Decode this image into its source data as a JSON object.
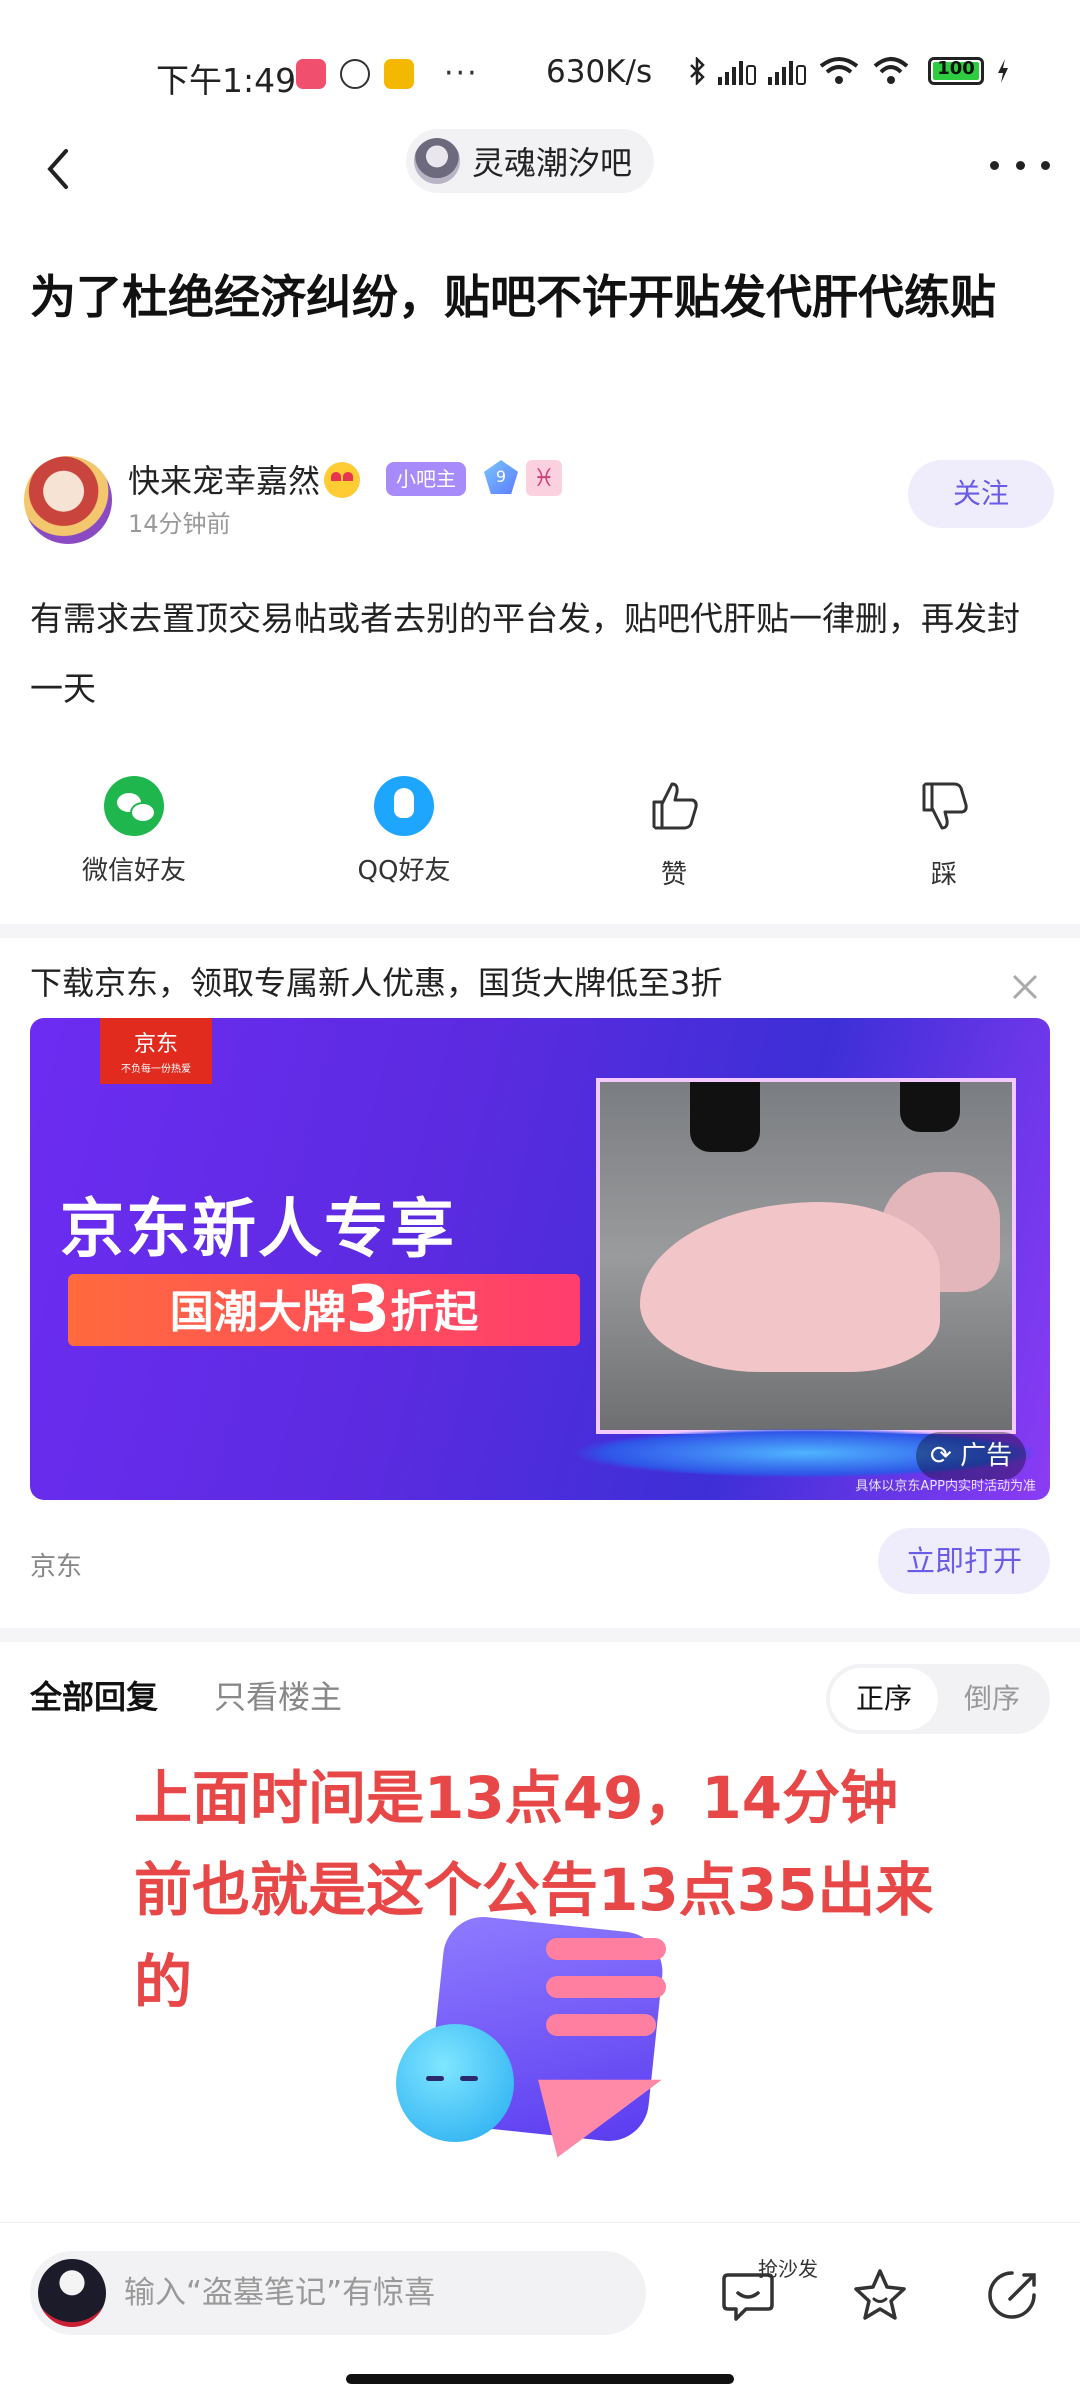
{
  "status_bar": {
    "time": "下午1:49",
    "net_speed": "630K/s",
    "battery": "100"
  },
  "nav": {
    "forum_name": "灵魂潮汐吧"
  },
  "post": {
    "title": "为了杜绝经济纠纷，贴吧不许开贴发代肝代练贴",
    "author": {
      "name": "快来宠幸嘉然",
      "role_badge": "小吧主",
      "level": "9",
      "zodiac": "♓",
      "time_ago": "14分钟前"
    },
    "follow_label": "关注",
    "body": "有需求去置顶交易帖或者去别的平台发，贴吧代肝贴一律删，再发封一天"
  },
  "share": {
    "wechat": "微信好友",
    "qq": "QQ好友",
    "like": "赞",
    "dislike": "踩"
  },
  "ad": {
    "caption": "下载京东，领取专属新人优惠，国货大牌低至3折",
    "logo": "京东",
    "logo_slogan": "不负每一份热爱",
    "headline": "京东新人专享",
    "sub_prefix": "国潮大牌",
    "sub_number": "3",
    "sub_suffix": "折起",
    "tag": "广告",
    "note": "具体以京东APP内实时活动为准",
    "source": "京东",
    "open_label": "立即打开"
  },
  "replies": {
    "tab_all": "全部回复",
    "tab_op": "只看楼主",
    "sort_asc": "正序",
    "sort_desc": "倒序"
  },
  "annotation": "上面时间是13点49，14分钟前也就是这个公告13点35出来的",
  "bottom_bar": {
    "input_placeholder": "输入“盗墓笔记”有惊喜",
    "sofa_label": "抢沙发"
  },
  "colors": {
    "accent": "#6b5ce7",
    "annotation_red": "#e84747",
    "wechat_green": "#1fb74d",
    "qq_blue": "#1ea6ff",
    "jd_red": "#e22b1f"
  }
}
